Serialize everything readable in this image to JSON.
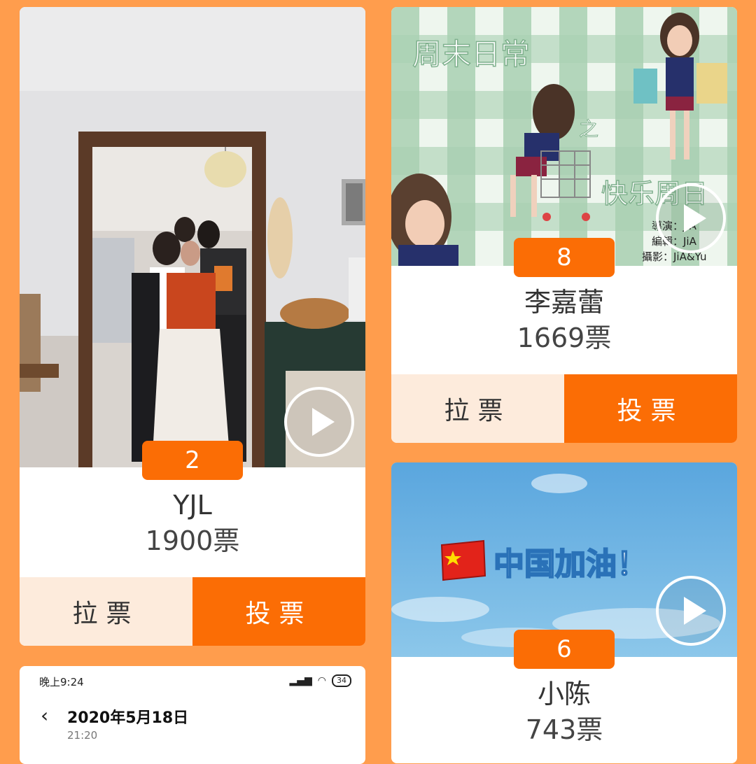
{
  "entries": [
    {
      "number": "2",
      "name": "YJL",
      "votes": "1900票",
      "canvass_label": "拉票",
      "vote_label": "投票"
    },
    {
      "number": "8",
      "name": "李嘉蕾",
      "votes": "1669票",
      "canvass_label": "拉票",
      "vote_label": "投票",
      "cover_text": {
        "title": "周末日常",
        "zhi": "之",
        "subtitle": "快乐周日",
        "credit1": "導演：JiA",
        "credit2": "編輯：JiA",
        "credit3": "攝影：JiA&Yu"
      }
    },
    {
      "number": "6",
      "name": "小陈",
      "votes": "743票",
      "cover_text": {
        "slogan": "中国加油！"
      }
    }
  ],
  "screenshot_preview": {
    "status_time": "晚上9:24",
    "battery": "34",
    "date": "2020年5月18日",
    "time": "21:20"
  },
  "colors": {
    "background": "#ff9d4d",
    "accent": "#fb6d05",
    "canvass_bg": "#fdebdc"
  },
  "icons": [
    "play-icon",
    "back-chevron-icon",
    "signal-icon",
    "wifi-icon",
    "battery-icon"
  ]
}
